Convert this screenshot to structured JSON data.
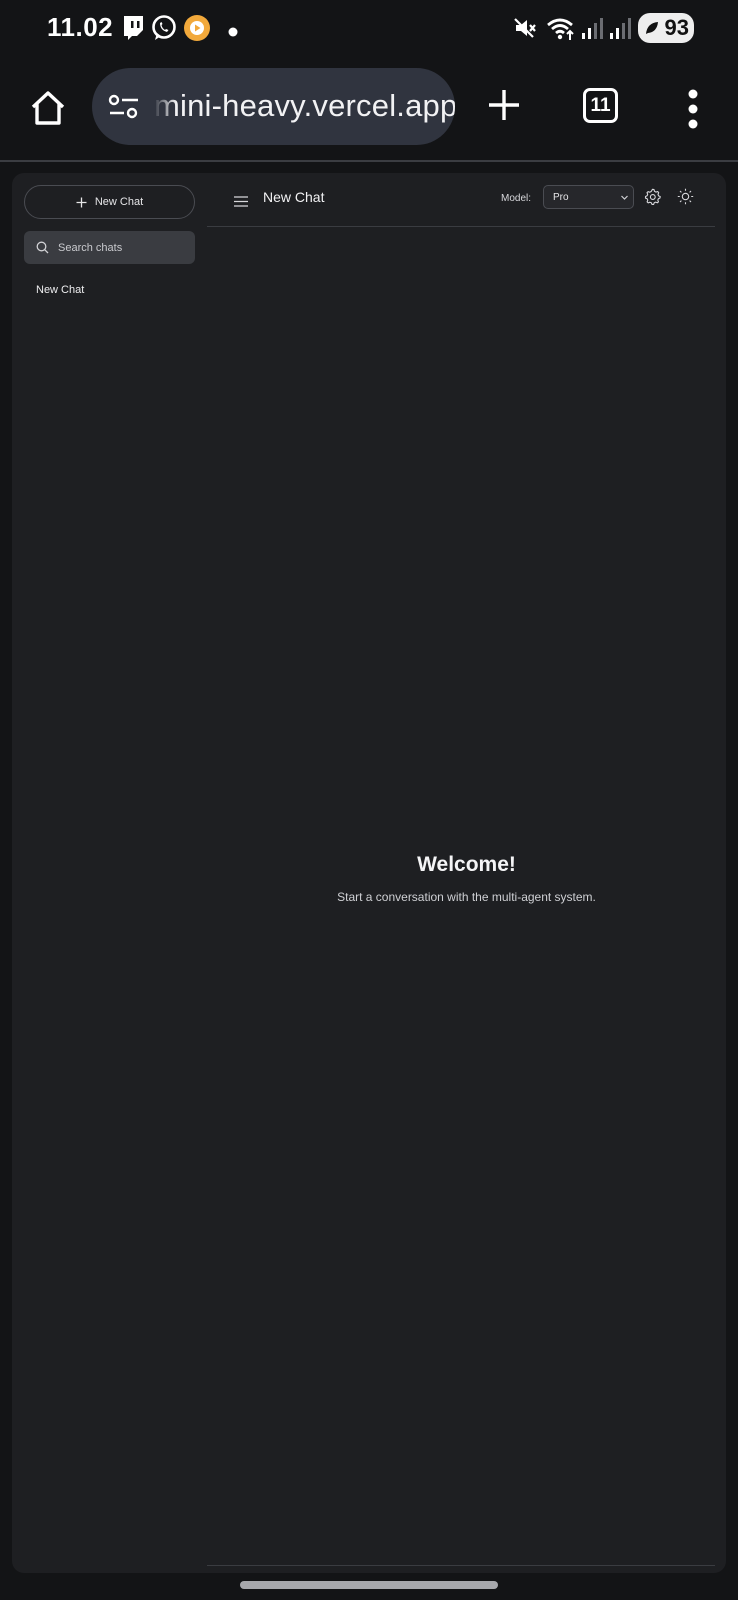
{
  "status_bar": {
    "time": "11.02",
    "battery": "93",
    "icons": [
      "twitch-icon",
      "whatsapp-icon",
      "media-play-icon",
      "notification-dot-icon",
      "mute-icon",
      "wifi-icon",
      "signal-icon",
      "signal-icon",
      "battery-icon"
    ]
  },
  "browser": {
    "url": "mini-heavy.vercel.app",
    "tab_count": "11",
    "icons": [
      "home-icon",
      "site-settings-icon",
      "plus-icon",
      "tabs-icon",
      "more-vert-icon"
    ]
  },
  "sidebar": {
    "new_chat_label": "New Chat",
    "search_placeholder": "Search chats",
    "chats": [
      {
        "title": "New Chat"
      }
    ]
  },
  "header": {
    "title": "New Chat",
    "model_label": "Model:",
    "model_value": "Pro"
  },
  "welcome": {
    "heading": "Welcome!",
    "subtext": "Start a conversation with the multi-agent system."
  },
  "colors": {
    "page_bg": "#131416",
    "app_bg": "#1e1f22",
    "url_pill": "#30343f",
    "search_bg": "#3a3c41",
    "border": "#3a3c41"
  }
}
